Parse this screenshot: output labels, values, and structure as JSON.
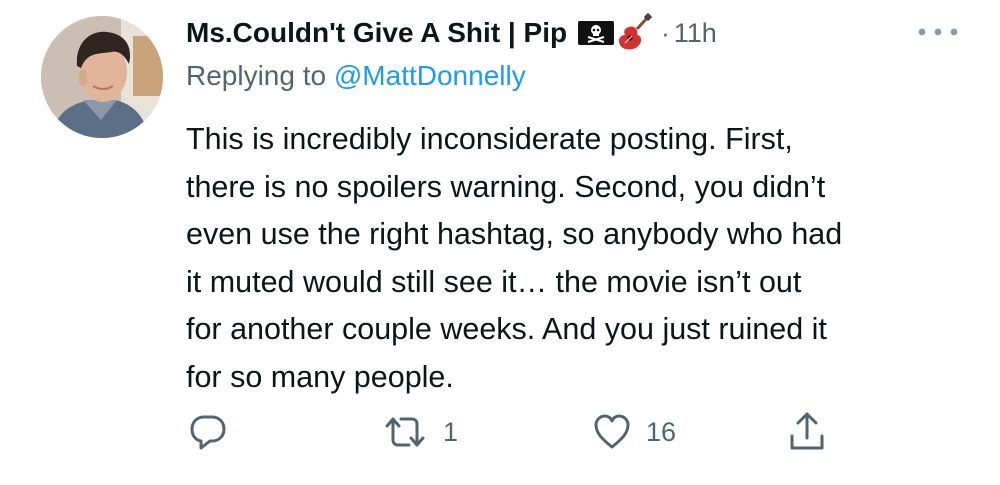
{
  "tweet": {
    "display_name": "Ms.Couldn't Give A Shit | Pip",
    "name_emojis": [
      "pirate-flag-icon",
      "guitar-icon"
    ],
    "separator": "·",
    "time_ago": "11h",
    "replying_prefix": "Replying to",
    "replying_handle": "@MattDonnelly",
    "body_lines": [
      "This is incredibly inconsiderate posting. First,",
      "there is no spoilers warning. Second, you didn’t",
      "even use the right hashtag, so anybody who had",
      "it muted would still see it… the movie isn’t out",
      "for another couple weeks. And you just ruined it",
      "for so many people."
    ],
    "actions": {
      "reply_icon": "reply-icon",
      "retweet_icon": "retweet-icon",
      "retweet_count": "1",
      "like_icon": "heart-icon",
      "like_count": "16",
      "share_icon": "share-icon"
    },
    "colors": {
      "text": "#0f1419",
      "secondary": "#536471",
      "link": "#1d9bf0",
      "background": "#ffffff"
    }
  }
}
